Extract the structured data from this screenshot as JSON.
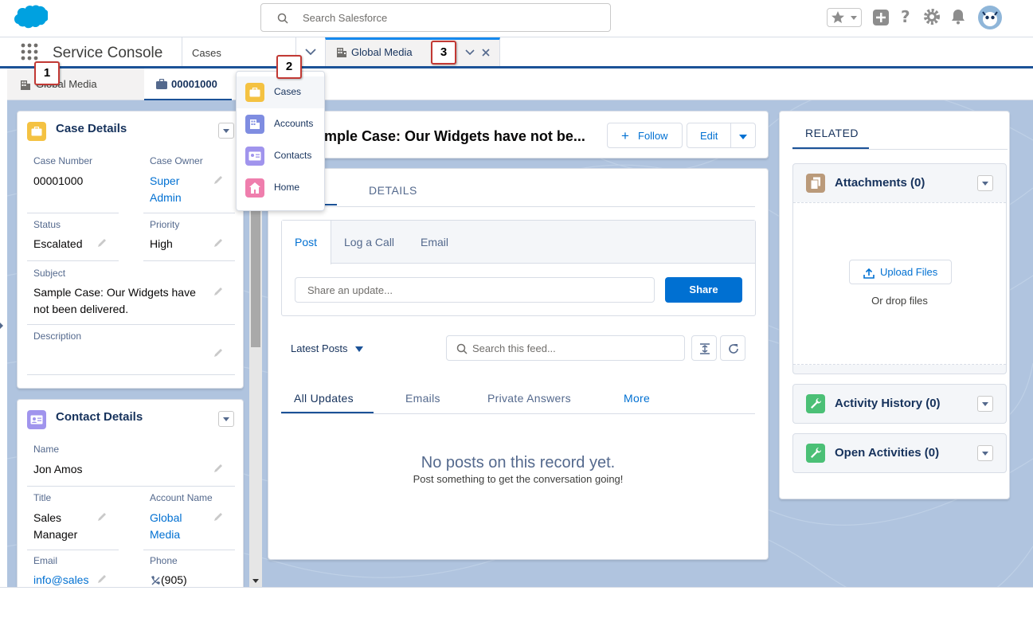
{
  "header": {
    "search_placeholder": "Search Salesforce"
  },
  "nav": {
    "app_name": "Service Console",
    "object_select": "Cases",
    "workspace_tab": "Global Media"
  },
  "subtabs": {
    "tab1": "Global Media",
    "tab2": "00001000"
  },
  "dropdown": {
    "items": [
      {
        "label": "Cases",
        "color": "#f4c242"
      },
      {
        "label": "Accounts",
        "color": "#7f8de1"
      },
      {
        "label": "Contacts",
        "color": "#a094ed"
      },
      {
        "label": "Home",
        "color": "#ef7ead"
      }
    ]
  },
  "markers": [
    "1",
    "2",
    "3"
  ],
  "case_details": {
    "title": "Case Details",
    "case_number_label": "Case Number",
    "case_number": "00001000",
    "case_owner_label": "Case Owner",
    "case_owner_line1": "Super",
    "case_owner_line2": "Admin",
    "status_label": "Status",
    "status": "Escalated",
    "priority_label": "Priority",
    "priority": "High",
    "subject_label": "Subject",
    "subject_line1": "Sample Case: Our Widgets have",
    "subject_line2": "not been delivered.",
    "description_label": "Description"
  },
  "contact_details": {
    "title": "Contact Details",
    "name_label": "Name",
    "name": "Jon Amos",
    "title_label": "Title",
    "title_line1": "Sales",
    "title_line2": "Manager",
    "account_label": "Account Name",
    "account_line1": "Global",
    "account_line2": "Media",
    "email_label": "Email",
    "email": "info@sales",
    "phone_label": "Phone",
    "phone": "(905)"
  },
  "record": {
    "title": "ample Case: Our Widgets have not be...",
    "follow": "Follow",
    "edit": "Edit",
    "details_tab": "DETAILS",
    "publisher_tabs": [
      "Post",
      "Log a Call",
      "Email"
    ],
    "share_placeholder": "Share an update...",
    "share_button": "Share",
    "sort": "Latest Posts",
    "feed_search_placeholder": "Search this feed...",
    "feed_tabs": [
      "All Updates",
      "Emails",
      "Private Answers",
      "More"
    ],
    "empty_title": "No posts on this record yet.",
    "empty_sub": "Post something to get the conversation going!"
  },
  "related": {
    "tab": "RELATED",
    "attachments": "Attachments (0)",
    "upload": "Upload Files",
    "drop": "Or drop files",
    "activity_history": "Activity History (0)",
    "open_activities": "Open Activities (0)"
  },
  "colors": {
    "brand": "#0070d2",
    "nav_border": "#1b5297",
    "canvas": "#b0c4df"
  }
}
